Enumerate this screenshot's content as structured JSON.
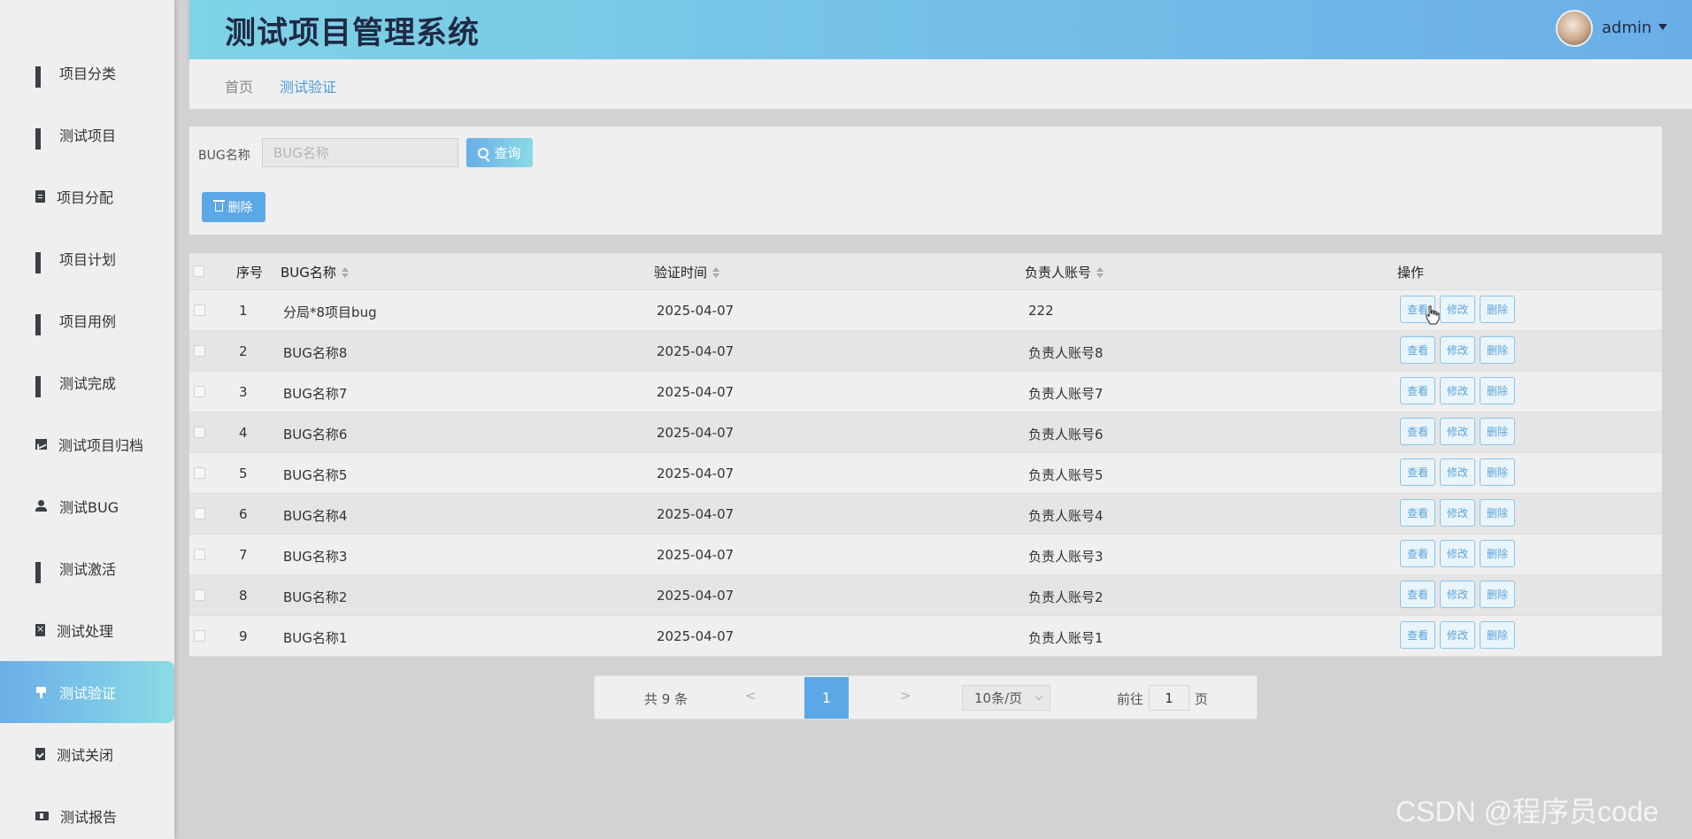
{
  "app": {
    "title": "测试项目管理系统"
  },
  "user": {
    "name": "admin"
  },
  "sidebar": {
    "items": [
      {
        "label": "项目分类",
        "icon": "grid-icon"
      },
      {
        "label": "测试项目",
        "icon": "grid-icon"
      },
      {
        "label": "项目分配",
        "icon": "clipboard-icon"
      },
      {
        "label": "项目计划",
        "icon": "grid-icon"
      },
      {
        "label": "项目用例",
        "icon": "grid-icon"
      },
      {
        "label": "测试完成",
        "icon": "grid-icon"
      },
      {
        "label": "测试项目归档",
        "icon": "chart-icon"
      },
      {
        "label": "测试BUG",
        "icon": "user-icon"
      },
      {
        "label": "测试激活",
        "icon": "grid-icon"
      },
      {
        "label": "测试处理",
        "icon": "clipboard-x-icon"
      },
      {
        "label": "测试验证",
        "icon": "brush-icon",
        "active": true
      },
      {
        "label": "测试关闭",
        "icon": "clipboard-check-icon"
      },
      {
        "label": "测试报告",
        "icon": "ticket-icon"
      }
    ]
  },
  "breadcrumb": {
    "home": "首页",
    "current": "测试验证"
  },
  "search": {
    "label": "BUG名称",
    "placeholder": "BUG名称",
    "value": "",
    "query_label": "查询",
    "delete_label": "删除"
  },
  "table": {
    "headers": {
      "index": "序号",
      "name": "BUG名称",
      "time": "验证时间",
      "owner": "负责人账号",
      "actions": "操作"
    },
    "action_labels": {
      "view": "查看",
      "edit": "修改",
      "delete": "删除"
    },
    "rows": [
      {
        "index": "1",
        "name": "分局*8项目bug",
        "time": "2025-04-07",
        "owner": "222"
      },
      {
        "index": "2",
        "name": "BUG名称8",
        "time": "2025-04-07",
        "owner": "负责人账号8"
      },
      {
        "index": "3",
        "name": "BUG名称7",
        "time": "2025-04-07",
        "owner": "负责人账号7"
      },
      {
        "index": "4",
        "name": "BUG名称6",
        "time": "2025-04-07",
        "owner": "负责人账号6"
      },
      {
        "index": "5",
        "name": "BUG名称5",
        "time": "2025-04-07",
        "owner": "负责人账号5"
      },
      {
        "index": "6",
        "name": "BUG名称4",
        "time": "2025-04-07",
        "owner": "负责人账号4"
      },
      {
        "index": "7",
        "name": "BUG名称3",
        "time": "2025-04-07",
        "owner": "负责人账号3"
      },
      {
        "index": "8",
        "name": "BUG名称2",
        "time": "2025-04-07",
        "owner": "负责人账号2"
      },
      {
        "index": "9",
        "name": "BUG名称1",
        "time": "2025-04-07",
        "owner": "负责人账号1"
      }
    ]
  },
  "pagination": {
    "total": "共 9 条",
    "prev": "<",
    "current_page": "1",
    "next": ">",
    "page_size": "10条/页",
    "goto_label": "前往",
    "goto_value": "1",
    "goto_unit": "页"
  },
  "watermark": "CSDN @程序员code",
  "colors": {
    "accent_start": "#6aaee8",
    "accent_end": "#8adbe6",
    "title": "#1f2a44"
  }
}
